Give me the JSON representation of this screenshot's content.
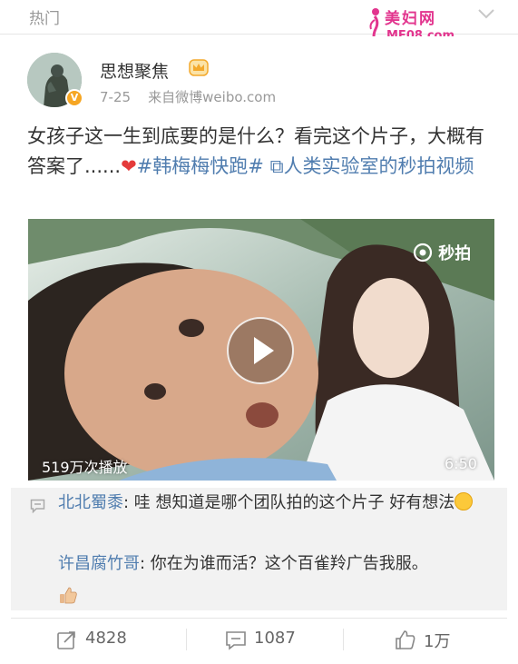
{
  "section": {
    "title": "热门"
  },
  "watermark": {
    "line1": "美妇网",
    "line2": "MF08.com"
  },
  "post": {
    "author": "思想聚焦",
    "date": "7-25",
    "source": "来自微博weibo.com",
    "text_part1": "女孩子这一生到底要的是什么？看完这个片子，大概有答案了......",
    "hashtag": "#韩梅梅快跑#",
    "link_text": "人类实验室的秒拍视频"
  },
  "video": {
    "logo_text": "秒拍",
    "plays": "519万次播放",
    "duration": "6:50"
  },
  "comments": [
    {
      "author": "北北蜀黍",
      "text": ": 哇 想知道是哪个团队拍的这个片子 好有想法"
    },
    {
      "author": "许昌腐竹哥",
      "text": ": 你在为谁而活？这个百雀羚广告我服。"
    }
  ],
  "actions": {
    "repost_count": "4828",
    "comment_count": "1087",
    "like_count": "1万"
  },
  "colors": {
    "link_blue": "#507daf",
    "watermark_pink": "#e2358e",
    "heart_red": "#e43b3b"
  }
}
